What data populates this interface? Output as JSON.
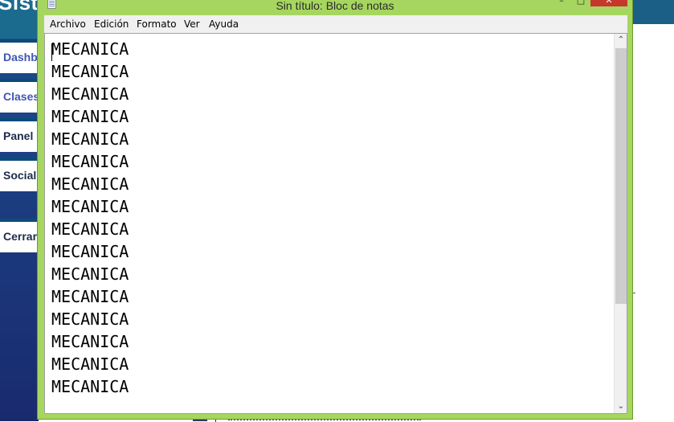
{
  "background_app": {
    "title": "Sist",
    "nav_items": [
      "Dashb",
      "Clases",
      "Panel",
      "Social",
      "Cerrar"
    ]
  },
  "window": {
    "title": "Sin título: Bloc de notas",
    "controls": {
      "minimize": "–",
      "maximize": "□",
      "close": "✕"
    }
  },
  "menu": [
    "Archivo",
    "Edición",
    "Formato",
    "Ver",
    "Ayuda"
  ],
  "document": {
    "lines": [
      "MECANICA",
      "MECANICA",
      "MECANICA",
      "MECANICA",
      "MECANICA",
      "MECANICA",
      "MECANICA",
      "MECANICA",
      "MECANICA",
      "MECANICA",
      "MECANICA",
      "MECANICA",
      "MECANICA",
      "MECANICA",
      "MECANICA",
      "MECANICA"
    ]
  },
  "scrollbar": {
    "up": "⌃",
    "down": "⌄",
    "position": 0
  },
  "icons": {
    "app_icon": "notepad-icon"
  },
  "colors": {
    "window_frame": "#a6d65f",
    "close_button": "#c7382c",
    "background_nav": "#1b4e8d"
  }
}
